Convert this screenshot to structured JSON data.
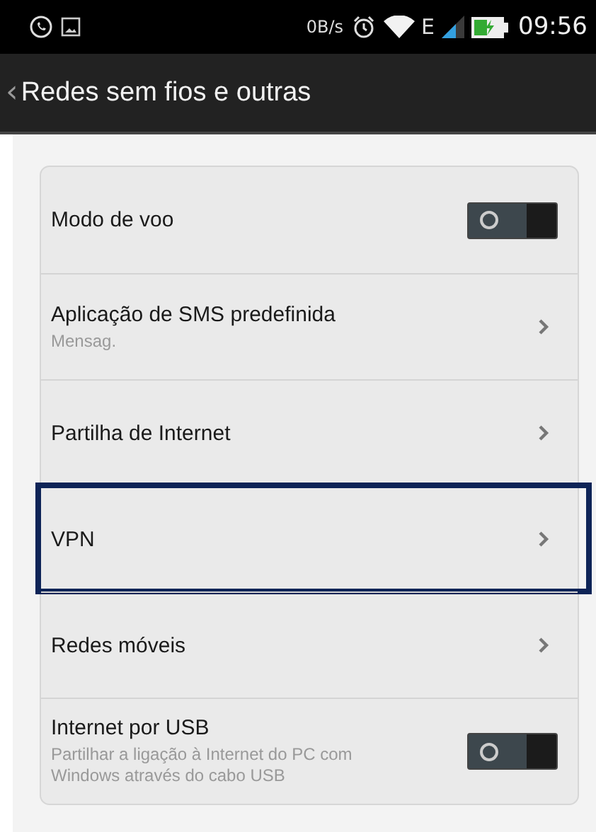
{
  "status_bar": {
    "speed": "0B/s",
    "network": "E",
    "time": "09:56"
  },
  "header": {
    "back": "‹",
    "title": "Redes sem fios e outras"
  },
  "settings": [
    {
      "kind": "toggle",
      "label": "Modo de voo",
      "on": false,
      "highlighted": false
    },
    {
      "kind": "link",
      "label": "Aplicação de SMS predefinida",
      "summary": "Mensag.",
      "highlighted": false
    },
    {
      "kind": "link",
      "label": "Partilha de Internet",
      "highlighted": false
    },
    {
      "kind": "link",
      "label": "VPN",
      "highlighted": true
    },
    {
      "kind": "link",
      "label": "Redes móveis",
      "highlighted": false
    },
    {
      "kind": "toggle",
      "label": "Internet por USB",
      "summary": "Partilhar a ligação à Internet do PC com Windows através do cabo USB",
      "on": false,
      "highlighted": false
    }
  ]
}
